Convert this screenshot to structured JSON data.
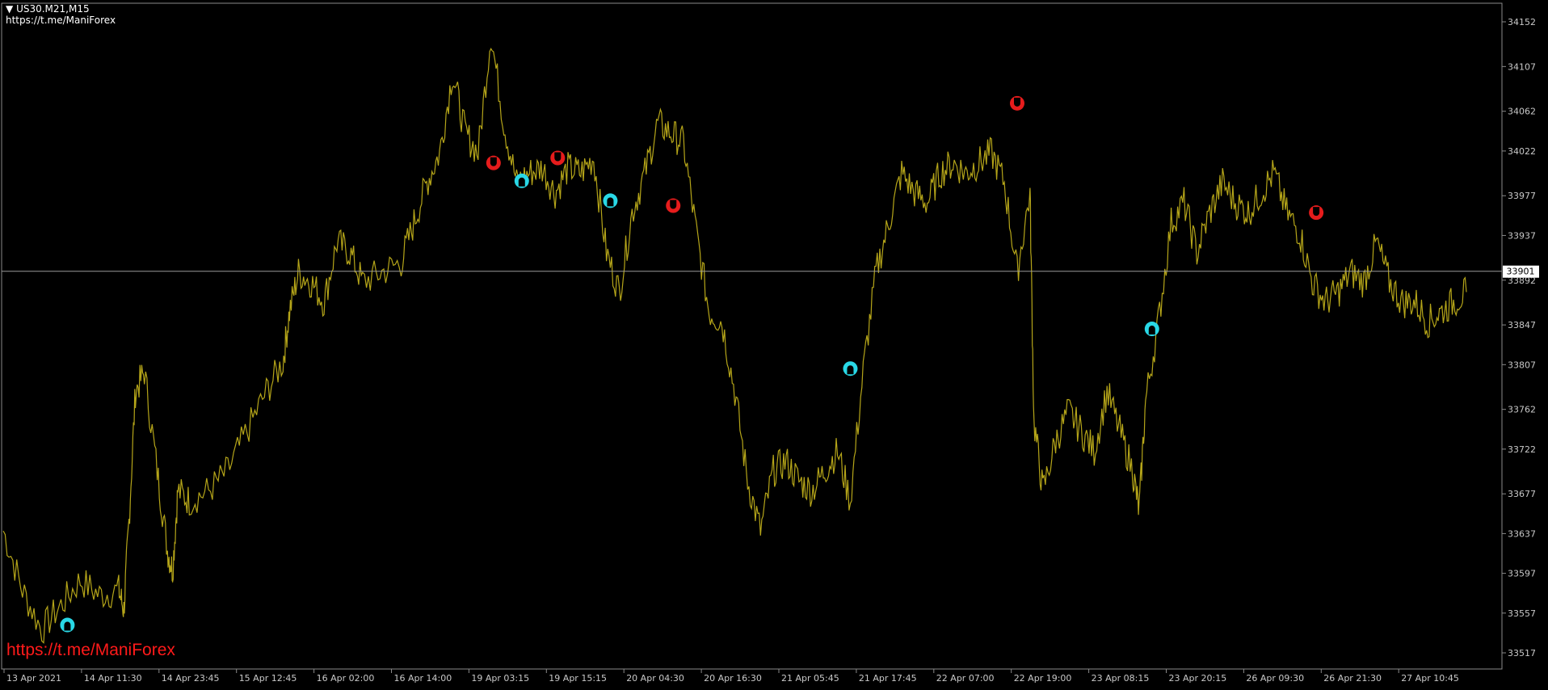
{
  "header": {
    "symbol_line": "US30.M21,M15",
    "link_line": "https://t.me/ManiForex"
  },
  "watermark": "https://t.me/ManiForex",
  "colors": {
    "background": "#000000",
    "price_line": "#b5a519",
    "axis": "#c8c8c8",
    "buy_signal": "#29d8e6",
    "sell_signal": "#e61c1c",
    "watermark": "#ff1a1a"
  },
  "chart_data": {
    "type": "line",
    "price_axis": {
      "ticks": [
        "34152",
        "34107",
        "34062",
        "34022",
        "33977",
        "33937",
        "33892",
        "33847",
        "33807",
        "33762",
        "33722",
        "33677",
        "33637",
        "33597",
        "33557",
        "33517"
      ],
      "current_price": "33901"
    },
    "time_axis": {
      "labels": [
        "13 Apr 2021",
        "14 Apr 11:30",
        "14 Apr 23:45",
        "15 Apr 12:45",
        "16 Apr 02:00",
        "16 Apr 14:00",
        "19 Apr 03:15",
        "19 Apr 15:15",
        "20 Apr 04:30",
        "20 Apr 16:30",
        "21 Apr 05:45",
        "21 Apr 17:45",
        "22 Apr 07:00",
        "22 Apr 19:00",
        "23 Apr 08:15",
        "23 Apr 20:15",
        "26 Apr 09:30",
        "26 Apr 21:30",
        "27 Apr 10:45"
      ]
    },
    "series": [
      {
        "values": [
          [
            0,
            33640
          ],
          [
            1.5,
            33580
          ],
          [
            3,
            33540
          ],
          [
            4.5,
            33565
          ],
          [
            6,
            33590
          ],
          [
            7.5,
            33575
          ],
          [
            9,
            33580
          ],
          [
            9.4,
            33560
          ],
          [
            9.8,
            33650
          ],
          [
            10.3,
            33780
          ],
          [
            11,
            33800
          ],
          [
            12,
            33700
          ],
          [
            12.8,
            33620
          ],
          [
            13.2,
            33600
          ],
          [
            13.6,
            33680
          ],
          [
            14.5,
            33670
          ],
          [
            16,
            33680
          ],
          [
            17.5,
            33700
          ],
          [
            19,
            33740
          ],
          [
            20.5,
            33780
          ],
          [
            21.8,
            33810
          ],
          [
            22.3,
            33860
          ],
          [
            23,
            33900
          ],
          [
            24,
            33890
          ],
          [
            25,
            33870
          ],
          [
            26,
            33930
          ],
          [
            27,
            33920
          ],
          [
            28,
            33890
          ],
          [
            29.5,
            33900
          ],
          [
            31,
            33910
          ],
          [
            32,
            33950
          ],
          [
            33,
            33990
          ],
          [
            34,
            34020
          ],
          [
            35,
            34100
          ],
          [
            36,
            34040
          ],
          [
            37,
            34020
          ],
          [
            38,
            34140
          ],
          [
            39,
            34050
          ],
          [
            40,
            33990
          ],
          [
            41,
            34000
          ],
          [
            42,
            34005
          ],
          [
            43,
            33980
          ],
          [
            44,
            34005
          ],
          [
            45,
            34000
          ],
          [
            46,
            34015
          ],
          [
            47,
            33920
          ],
          [
            48,
            33880
          ],
          [
            49,
            33960
          ],
          [
            50,
            34000
          ],
          [
            51,
            34050
          ],
          [
            52,
            34040
          ],
          [
            53,
            34030
          ],
          [
            54,
            33940
          ],
          [
            55,
            33860
          ],
          [
            56,
            33850
          ],
          [
            57,
            33780
          ],
          [
            58,
            33690
          ],
          [
            59,
            33640
          ],
          [
            60,
            33700
          ],
          [
            61,
            33710
          ],
          [
            62,
            33690
          ],
          [
            63,
            33680
          ],
          [
            64,
            33700
          ],
          [
            65,
            33720
          ],
          [
            66,
            33670
          ],
          [
            67,
            33800
          ],
          [
            68,
            33900
          ],
          [
            69,
            33950
          ],
          [
            70,
            34000
          ],
          [
            71,
            33980
          ],
          [
            72,
            33970
          ],
          [
            73,
            34000
          ],
          [
            74,
            34010
          ],
          [
            75,
            34000
          ],
          [
            76,
            34010
          ],
          [
            77,
            34020
          ],
          [
            78,
            33990
          ],
          [
            79,
            33900
          ],
          [
            80,
            33980
          ],
          [
            80.3,
            33750
          ],
          [
            81,
            33680
          ],
          [
            82,
            33730
          ],
          [
            83,
            33760
          ],
          [
            84,
            33740
          ],
          [
            85,
            33720
          ],
          [
            86,
            33780
          ],
          [
            87,
            33740
          ],
          [
            88,
            33700
          ],
          [
            88.5,
            33660
          ],
          [
            89,
            33770
          ],
          [
            90,
            33850
          ],
          [
            91,
            33950
          ],
          [
            92,
            33970
          ],
          [
            93,
            33920
          ],
          [
            94,
            33960
          ],
          [
            95,
            33990
          ],
          [
            96,
            33970
          ],
          [
            97,
            33960
          ],
          [
            98,
            33980
          ],
          [
            99,
            34000
          ],
          [
            100,
            33960
          ],
          [
            101,
            33940
          ],
          [
            102,
            33890
          ],
          [
            103,
            33870
          ],
          [
            104,
            33880
          ],
          [
            105,
            33900
          ],
          [
            106,
            33890
          ],
          [
            107,
            33930
          ],
          [
            108,
            33890
          ],
          [
            109,
            33870
          ],
          [
            110,
            33870
          ],
          [
            111,
            33850
          ],
          [
            112,
            33860
          ],
          [
            113,
            33870
          ],
          [
            114,
            33880
          ]
        ]
      }
    ],
    "signals": [
      {
        "type": "buy",
        "x": 5,
        "y": 33545
      },
      {
        "type": "sell",
        "x": 38.2,
        "y": 34010
      },
      {
        "type": "buy",
        "x": 40.4,
        "y": 33992
      },
      {
        "type": "sell",
        "x": 43.2,
        "y": 34015
      },
      {
        "type": "buy",
        "x": 47.3,
        "y": 33972
      },
      {
        "type": "sell",
        "x": 52.2,
        "y": 33967
      },
      {
        "type": "buy",
        "x": 66,
        "y": 33803
      },
      {
        "type": "sell",
        "x": 79,
        "y": 34070
      },
      {
        "type": "buy",
        "x": 89.5,
        "y": 33843
      },
      {
        "type": "sell",
        "x": 102.3,
        "y": 33960
      }
    ]
  }
}
